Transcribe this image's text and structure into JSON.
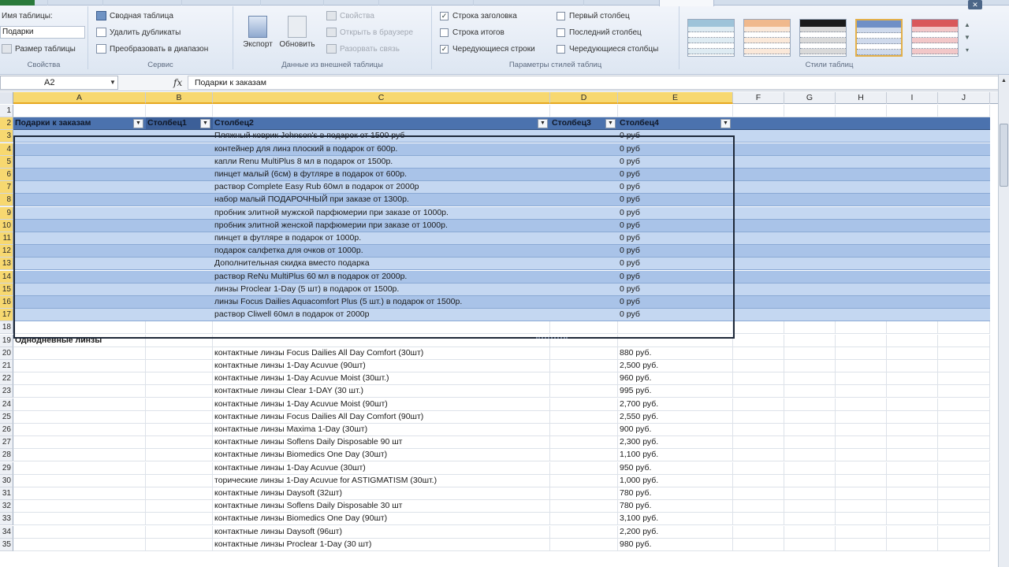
{
  "ribbon": {
    "properties": {
      "table_name_label": "Имя таблицы:",
      "table_name_value": "Подарки",
      "resize_label": "Размер таблицы",
      "group_label": "Свойства"
    },
    "tools": {
      "summarize_pivot": "Сводная таблица",
      "remove_duplicates": "Удалить дубликаты",
      "convert_to_range": "Преобразовать в диапазон",
      "group_label": "Сервис"
    },
    "external": {
      "export": "Экспорт",
      "refresh": "Обновить",
      "properties": "Свойства",
      "open_in_browser": "Открыть в браузере",
      "unlink": "Разорвать связь",
      "group_label": "Данные из внешней таблицы"
    },
    "style_options": {
      "header_row": "Строка заголовка",
      "total_row": "Строка итогов",
      "banded_rows": "Чередующиеся строки",
      "first_column": "Первый столбец",
      "last_column": "Последний столбец",
      "banded_columns": "Чередующиеся столбцы",
      "header_row_checked": true,
      "total_row_checked": false,
      "banded_rows_checked": true,
      "first_column_checked": false,
      "last_column_checked": false,
      "banded_columns_checked": false,
      "group_label": "Параметры стилей таблиц"
    },
    "table_styles": {
      "group_label": "Стили таблиц",
      "swatch_colors": [
        "#9dc3d9",
        "#f0b98d",
        "#1a1a1a",
        "#6f8fc6",
        "#d9585b"
      ]
    }
  },
  "formula_bar": {
    "name_box": "A2",
    "fx": "fx",
    "formula": "Подарки к заказам"
  },
  "columns": [
    "A",
    "B",
    "C",
    "D",
    "E",
    "F",
    "G",
    "H",
    "I",
    "J"
  ],
  "table_header": {
    "col_a": "Подарки к заказам",
    "col_b": "Столбец1",
    "col_c": "Столбец2",
    "col_d": "Столбец3",
    "col_e": "Столбец4"
  },
  "table_rows": [
    {
      "c": "Пляжный коврик Johnson's в подарок от 1500 руб",
      "e": "0 руб"
    },
    {
      "c": "контейнер для линз плоский в подарок от 600р.",
      "e": "0 руб"
    },
    {
      "c": "капли Renu MultiPlus 8 мл в подарок от 1500р.",
      "e": "0 руб"
    },
    {
      "c": "пинцет малый (6см) в футляре в подарок от 600р.",
      "e": "0 руб"
    },
    {
      "c": "раствор Complete Easy Rub 60мл  в подарок от 2000р",
      "e": "0 руб"
    },
    {
      "c": "набор малый ПОДАРОЧНЫЙ при заказе от 1300р.",
      "e": "0 руб"
    },
    {
      "c": "пробник элитной мужской парфюмерии при заказе от 1000р.",
      "e": "0 руб"
    },
    {
      "c": "пробник элитной женской парфюмерии при заказе от 1000р.",
      "e": "0 руб"
    },
    {
      "c": "пинцет в футляре в подарок от 1000р.",
      "e": "0 руб"
    },
    {
      "c": "подарок салфетка для очков от 1000р.",
      "e": "0 руб"
    },
    {
      "c": "Дополнительная скидка вместо подарка",
      "e": "0 руб"
    },
    {
      "c": "раствор ReNu MultiPlus 60 мл в подарок от 2000р.",
      "e": "0 руб"
    },
    {
      "c": "линзы Proclear 1-Day (5 шт) в подарок от 1500р.",
      "e": "0 руб"
    },
    {
      "c": "линзы Focus Dailies Aquacomfort Plus (5 шт.) в подарок от 1500р.",
      "e": "0 руб"
    },
    {
      "c": "раствор Cliwell 60мл в подарок от 2000р",
      "e": "0 руб"
    }
  ],
  "section_title": "Однодневные линзы",
  "product_rows": [
    {
      "c": "контактные линзы Focus Dailies All Day Comfort (30шт)",
      "e": "880 руб."
    },
    {
      "c": "контактные линзы 1-Day Acuvue  (90шт)",
      "e": "2,500 руб."
    },
    {
      "c": "контактные линзы 1-Day Acuvue Moist  (30шт.)",
      "e": "960 руб."
    },
    {
      "c": "контактные линзы Clear 1-DAY (30 шт.)",
      "e": "995 руб."
    },
    {
      "c": "контактные линзы 1-Day Acuvue Moist (90шт)",
      "e": "2,700 руб."
    },
    {
      "c": "контактные линзы Focus Dailies All Day Comfort (90шт)",
      "e": "2,550 руб."
    },
    {
      "c": "контактные линзы Maxima 1-Day (30шт)",
      "e": "900 руб."
    },
    {
      "c": "контактные линзы Soflens Daily Disposable 90 шт",
      "e": "2,300 руб."
    },
    {
      "c": "контактные линзы Biomedics One Day (30шт)",
      "e": "1,100 руб."
    },
    {
      "c": "контактные линзы 1-Day Acuvue  (30шт)",
      "e": "950 руб."
    },
    {
      "c": "торические линзы 1-Day Acuvue for ASTIGMATISM (30шт.)",
      "e": "1,000 руб."
    },
    {
      "c": "контактные линзы Daysoft (32шт)",
      "e": "780 руб."
    },
    {
      "c": "контактные линзы Soflens Daily Disposable 30 шт",
      "e": "780 руб."
    },
    {
      "c": "контактные линзы Biomedics One Day (90шт)",
      "e": "3,100 руб."
    },
    {
      "c": "контактные линзы Daysoft (96шт)",
      "e": "2,200 руб."
    },
    {
      "c": "контактные линзы Proclear 1-Day (30 шт)",
      "e": "980 руб."
    }
  ]
}
